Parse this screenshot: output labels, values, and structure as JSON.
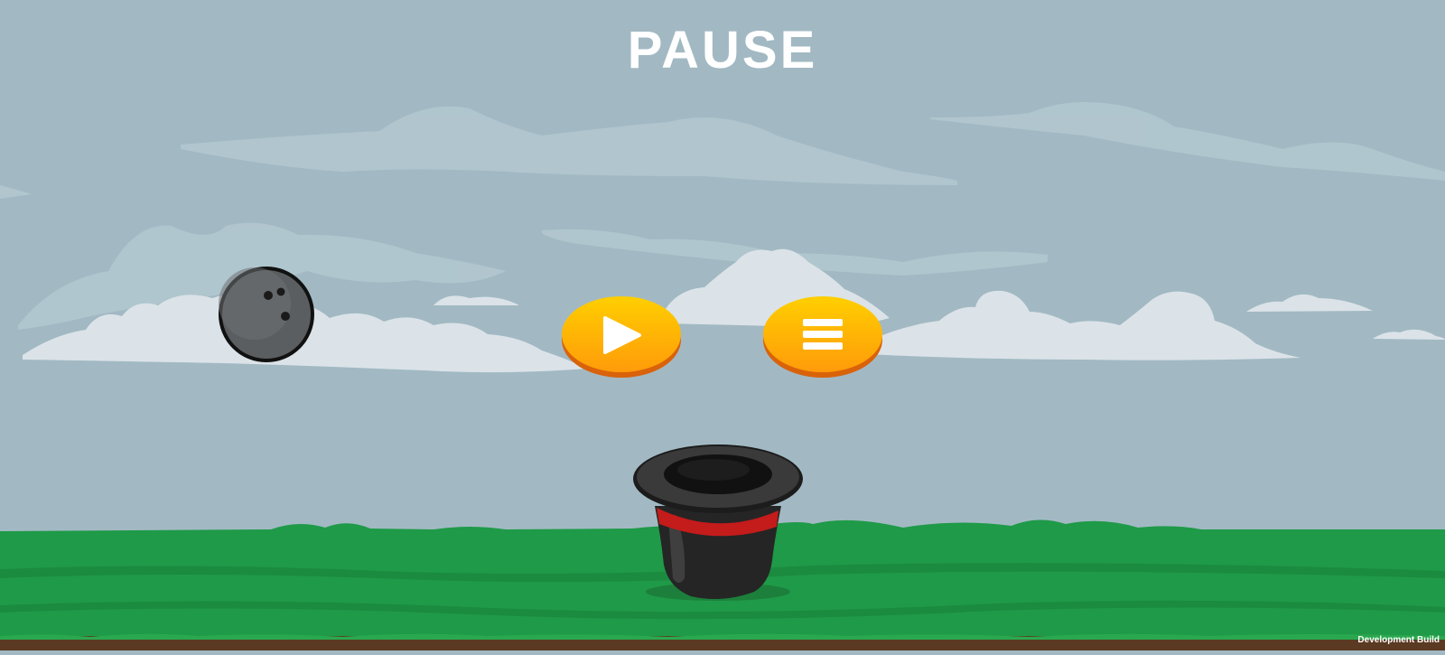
{
  "screen": {
    "title": "PAUSE"
  },
  "buttons": {
    "resume": {
      "icon": "play-icon"
    },
    "menu": {
      "icon": "hamburger-menu-icon"
    }
  },
  "objects": {
    "ball": "bowling-ball",
    "hat": "magic-top-hat"
  },
  "overlay": {
    "build_label": "Development Build"
  },
  "colors": {
    "sky": "#a2b9c3",
    "grass": "#1f9a48",
    "soil": "#5a3a22",
    "button": "#ffb000",
    "button_shadow": "#d9620a",
    "hat_band": "#c41b1b"
  }
}
